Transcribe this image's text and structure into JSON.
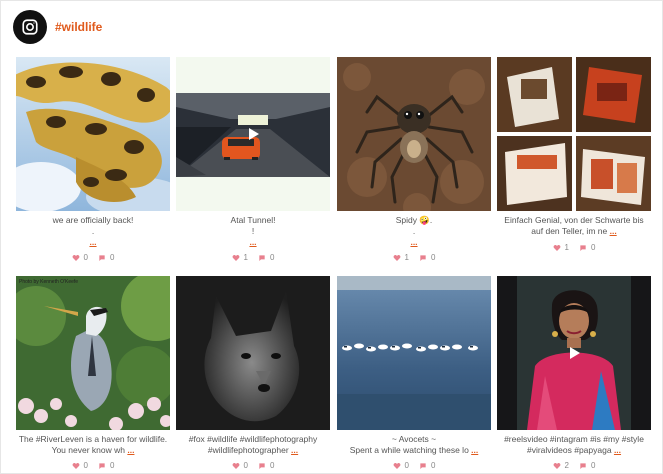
{
  "header": {
    "hashtag": "#wildlife",
    "icon": "instagram-icon"
  },
  "posts": [
    {
      "caption_lines": [
        "we are officially back!",
        "."
      ],
      "more": "...",
      "likes": "0",
      "comments": "0"
    },
    {
      "caption_lines": [
        "Atal Tunnel!",
        "!"
      ],
      "more": "...",
      "likes": "1",
      "comments": "0",
      "video": true
    },
    {
      "caption_lines": [
        "Spidy 🤪.",
        "."
      ],
      "more": "...",
      "likes": "1",
      "comments": "0"
    },
    {
      "caption_lines": [
        "Einfach Genial, von der Schwarte bis",
        "auf den Teller, im ne"
      ],
      "more": "...",
      "likes": "1",
      "comments": "0"
    },
    {
      "caption_lines": [
        "The #RiverLeven is a haven for wildlife.",
        "You never know wh"
      ],
      "more": "...",
      "likes": "0",
      "comments": "0",
      "credit": "Photo by Kenneth O'Keefe"
    },
    {
      "caption_lines": [
        "#fox #wildlife #wildlifephotography",
        "#wildlifephotographer"
      ],
      "more": "...",
      "likes": "0",
      "comments": "0"
    },
    {
      "caption_lines": [
        "~ Avocets ~",
        "Spent a while watching these lo"
      ],
      "more": "...",
      "likes": "0",
      "comments": "0"
    },
    {
      "caption_lines": [
        "#reelsvideo #intagram #is #my #style",
        "#viralvideos #papyaga"
      ],
      "more": "...",
      "likes": "2",
      "comments": "0",
      "video": true
    }
  ],
  "colors": {
    "accent": "#e05a1c",
    "heart": "#e8808e"
  }
}
